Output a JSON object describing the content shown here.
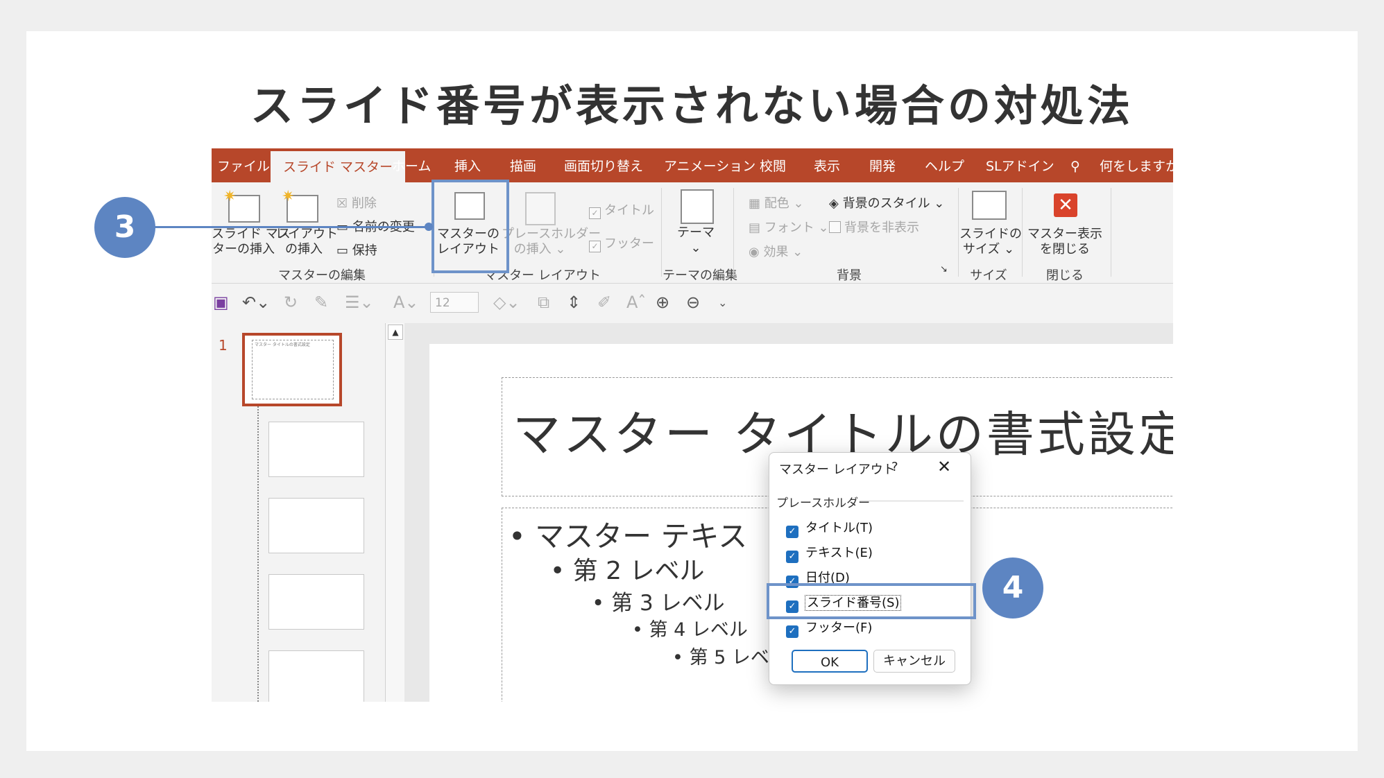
{
  "page_title": "スライド番号が表示されない場合の対処法",
  "tabs": [
    "ファイル",
    "スライド マスター",
    "ホーム",
    "挿入",
    "描画",
    "画面切り替え",
    "アニメーション",
    "校閲",
    "表示",
    "開発",
    "ヘルプ",
    "SLアドイン",
    "何をしますか"
  ],
  "ribbon": {
    "insert_master": [
      "スライド マス",
      "ターの挿入"
    ],
    "insert_layout": [
      "レイアウト",
      "の挿入"
    ],
    "delete": "削除",
    "rename": "名前の変更",
    "preserve": "保持",
    "master_layout": [
      "マスターの",
      "レイアウト"
    ],
    "insert_placeholder": [
      "プレースホルダー",
      "の挿入 ⌄"
    ],
    "title_check": "タイトル",
    "footer_check": "フッター",
    "theme": "テーマ",
    "colors": "配色 ⌄",
    "fonts": "フォント ⌄",
    "effects": "効果 ⌄",
    "bg_style": "背景のスタイル ⌄",
    "hide_bg": "背景を非表示",
    "slide_size": [
      "スライドの",
      "サイズ ⌄"
    ],
    "close_master": [
      "マスター表示",
      "を閉じる"
    ],
    "groups": {
      "edit_master": "マスターの編集",
      "master_layout": "マスター レイアウト",
      "edit_theme": "テーマの編集",
      "background": "背景",
      "size": "サイズ",
      "close": "閉じる"
    }
  },
  "qat": {
    "font_size": "12"
  },
  "thumbnails": {
    "slide_number": "1",
    "thumb_title": "マスター タイトルの書式設定"
  },
  "slide": {
    "title": "マスター タイトルの書式設定",
    "level1": "• マスター テキス",
    "level2": "• 第 2 レベル",
    "level3": "• 第 3 レベル",
    "level4": "• 第 4 レベル",
    "level5": "• 第 5 レベ"
  },
  "dialog": {
    "title": "マスター レイアウト",
    "help": "?",
    "close": "✕",
    "group": "プレースホルダー",
    "items": [
      "タイトル(T)",
      "テキスト(E)",
      "日付(D)",
      "スライド番号(S)",
      "フッター(F)"
    ],
    "ok": "OK",
    "cancel": "キャンセル"
  },
  "callouts": [
    "3",
    "4"
  ],
  "colors": {
    "accent": "#b7472a",
    "callout": "#5d85c2",
    "checkbox": "#1e6fbf"
  }
}
